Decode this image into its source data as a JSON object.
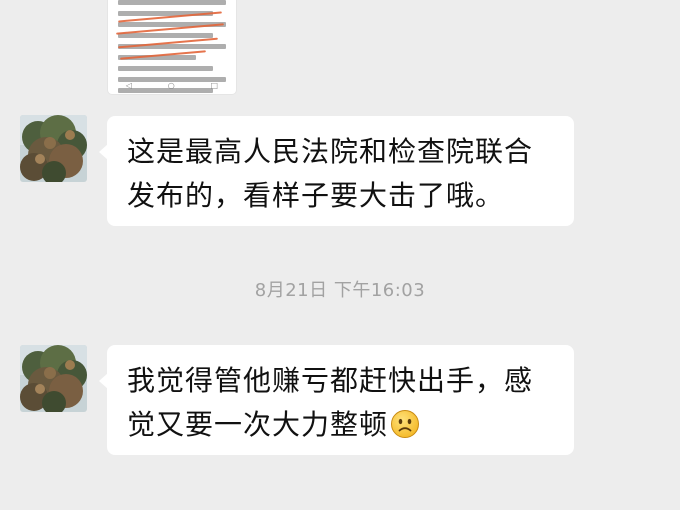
{
  "chat": {
    "messages": [
      {
        "type": "image",
        "description": "screenshot-thumbnail"
      },
      {
        "type": "text",
        "text": "这是最高人民法院和检查院联合发布的，看样子要大击了哦。"
      },
      {
        "type": "text",
        "text": "我觉得管他赚亏都赶快出手，感觉又要一次大力整顿",
        "emoji": "sad-face-icon"
      }
    ],
    "timestamp": "8月21日 下午16:03"
  },
  "colors": {
    "background": "#ededed",
    "bubble": "#ffffff",
    "timestamp_text": "#a2a2a2",
    "underline_accent": "#e2653a"
  }
}
